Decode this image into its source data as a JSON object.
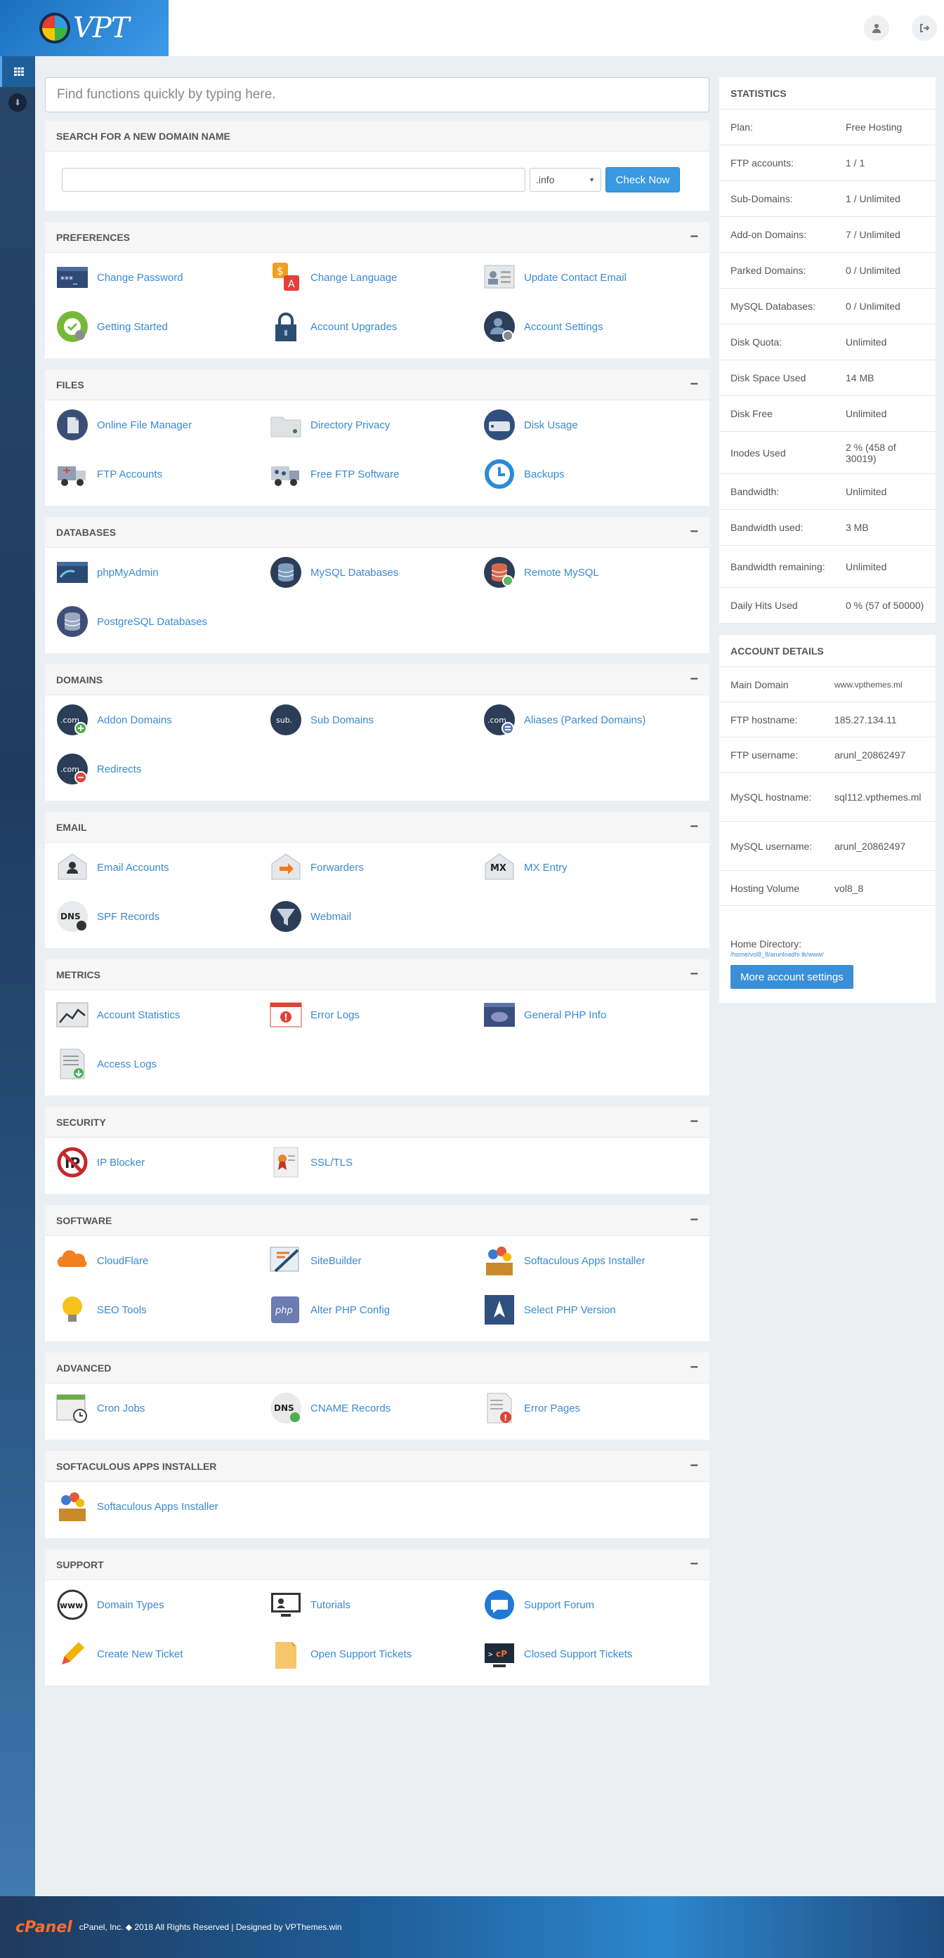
{
  "brand": {
    "logo_text": "VPT"
  },
  "topbar": {
    "user_icon": "user-icon",
    "logout_icon": "logout-icon"
  },
  "search": {
    "placeholder": "Find functions quickly by typing here."
  },
  "domain_search": {
    "title": "SEARCH FOR A NEW DOMAIN NAME",
    "tld": ".info",
    "button": "Check Now"
  },
  "panels": [
    {
      "key": "preferences",
      "title": "PREFERENCES",
      "items": [
        {
          "label": "Change Password",
          "icon": "password-icon"
        },
        {
          "label": "Change Language",
          "icon": "language-icon"
        },
        {
          "label": "Update Contact Email",
          "icon": "contact-card-icon"
        },
        {
          "label": "Getting Started",
          "icon": "getting-started-icon"
        },
        {
          "label": "Account Upgrades",
          "icon": "lock-icon"
        },
        {
          "label": "Account Settings",
          "icon": "user-settings-icon"
        }
      ]
    },
    {
      "key": "files",
      "title": "FILES",
      "items": [
        {
          "label": "Online File Manager",
          "icon": "file-manager-icon"
        },
        {
          "label": "Directory Privacy",
          "icon": "folder-privacy-icon"
        },
        {
          "label": "Disk Usage",
          "icon": "disk-usage-icon"
        },
        {
          "label": "FTP Accounts",
          "icon": "ftp-truck-icon"
        },
        {
          "label": "Free FTP Software",
          "icon": "ftp-software-icon"
        },
        {
          "label": "Backups",
          "icon": "backup-icon"
        }
      ]
    },
    {
      "key": "databases",
      "title": "DATABASES",
      "items": [
        {
          "label": "phpMyAdmin",
          "icon": "phpmyadmin-icon"
        },
        {
          "label": "MySQL Databases",
          "icon": "database-icon"
        },
        {
          "label": "Remote MySQL",
          "icon": "remote-database-icon"
        },
        {
          "label": "PostgreSQL Databases",
          "icon": "postgresql-icon"
        }
      ]
    },
    {
      "key": "domains",
      "title": "DOMAINS",
      "items": [
        {
          "label": "Addon Domains",
          "icon": "addon-domain-icon"
        },
        {
          "label": "Sub Domains",
          "icon": "subdomain-icon"
        },
        {
          "label": "Aliases (Parked Domains)",
          "icon": "alias-domain-icon"
        },
        {
          "label": "Redirects",
          "icon": "redirect-icon"
        }
      ]
    },
    {
      "key": "email",
      "title": "EMAIL",
      "items": [
        {
          "label": "Email Accounts",
          "icon": "email-account-icon"
        },
        {
          "label": "Forwarders",
          "icon": "forwarder-icon"
        },
        {
          "label": "MX Entry",
          "icon": "mx-entry-icon"
        },
        {
          "label": "SPF Records",
          "icon": "spf-dns-icon"
        },
        {
          "label": "Webmail",
          "icon": "webmail-funnel-icon"
        }
      ]
    },
    {
      "key": "metrics",
      "title": "METRICS",
      "items": [
        {
          "label": "Account Statistics",
          "icon": "statistics-chart-icon"
        },
        {
          "label": "Error Logs",
          "icon": "error-log-icon"
        },
        {
          "label": "General PHP Info",
          "icon": "php-info-icon"
        },
        {
          "label": "Access Logs",
          "icon": "access-log-icon"
        }
      ]
    },
    {
      "key": "security",
      "title": "SECURITY",
      "items": [
        {
          "label": "IP Blocker",
          "icon": "ip-blocker-icon"
        },
        {
          "label": "SSL/TLS",
          "icon": "ssl-certificate-icon"
        }
      ]
    },
    {
      "key": "software",
      "title": "SOFTWARE",
      "items": [
        {
          "label": "CloudFlare",
          "icon": "cloudflare-icon"
        },
        {
          "label": "SiteBuilder",
          "icon": "sitebuilder-icon"
        },
        {
          "label": "Softaculous Apps Installer",
          "icon": "softaculous-icon"
        },
        {
          "label": "SEO Tools",
          "icon": "lightbulb-icon"
        },
        {
          "label": "Alter PHP Config",
          "icon": "php-config-icon"
        },
        {
          "label": "Select PHP Version",
          "icon": "php-version-icon"
        }
      ]
    },
    {
      "key": "advanced",
      "title": "ADVANCED",
      "items": [
        {
          "label": "Cron Jobs",
          "icon": "cron-calendar-icon"
        },
        {
          "label": "CNAME Records",
          "icon": "cname-dns-icon"
        },
        {
          "label": "Error Pages",
          "icon": "error-page-icon"
        }
      ]
    },
    {
      "key": "softaculous",
      "title": "SOFTACULOUS APPS INSTALLER",
      "items": [
        {
          "label": "Softaculous Apps Installer",
          "icon": "softaculous-icon"
        }
      ]
    },
    {
      "key": "support",
      "title": "SUPPORT",
      "items": [
        {
          "label": "Domain Types",
          "icon": "www-globe-icon"
        },
        {
          "label": "Tutorials",
          "icon": "tutorial-icon"
        },
        {
          "label": "Support Forum",
          "icon": "forum-bubble-icon"
        },
        {
          "label": "Create New Ticket",
          "icon": "pencil-icon"
        },
        {
          "label": "Open Support Tickets",
          "icon": "open-ticket-icon"
        },
        {
          "label": "Closed Support Tickets",
          "icon": "terminal-ticket-icon"
        }
      ]
    }
  ],
  "statistics": {
    "title": "STATISTICS",
    "rows": [
      {
        "k": "Plan:",
        "v": "Free Hosting"
      },
      {
        "k": "FTP accounts:",
        "v": "1 / 1"
      },
      {
        "k": "Sub-Domains:",
        "v": "1 / Unlimited"
      },
      {
        "k": "Add-on Domains:",
        "v": "7 / Unlimited"
      },
      {
        "k": "Parked Domains:",
        "v": "0 / Unlimited"
      },
      {
        "k": "MySQL Databases:",
        "v": "0 / Unlimited"
      },
      {
        "k": "Disk Quota:",
        "v": "Unlimited"
      },
      {
        "k": "Disk Space Used",
        "v": "14 MB"
      },
      {
        "k": "Disk Free",
        "v": "Unlimited"
      },
      {
        "k": "Inodes Used",
        "v": "2 % (458 of 30019)"
      },
      {
        "k": "Bandwidth:",
        "v": "Unlimited"
      },
      {
        "k": "Bandwidth used:",
        "v": "3 MB"
      },
      {
        "k": "Bandwidth remaining:",
        "v": "Unlimited"
      },
      {
        "k": "Daily Hits Used",
        "v": "0 % (57 of 50000)"
      }
    ]
  },
  "account": {
    "title": "ACCOUNT DETAILS",
    "rows": [
      {
        "k": "Main Domain",
        "v": "www.vpthemes.ml"
      },
      {
        "k": "FTP hostname:",
        "v": "185.27.134.11"
      },
      {
        "k": "FTP username:",
        "v": "arunl_20862497"
      },
      {
        "k": "MySQL hostname:",
        "v": "sql112.vpthemes.ml"
      },
      {
        "k": "MySQL username:",
        "v": "arunl_20862497"
      },
      {
        "k": "Hosting Volume",
        "v": "vol8_8"
      }
    ],
    "home_label": "Home Directory:",
    "home_path": "/home/vol8_8/arunloadhi.tk/www/",
    "button": "More account settings"
  },
  "footer": {
    "logo": "cPanel",
    "text": "cPanel, Inc. ◆ 2018 All Rights Reserved | Designed by VPThemes.win"
  }
}
